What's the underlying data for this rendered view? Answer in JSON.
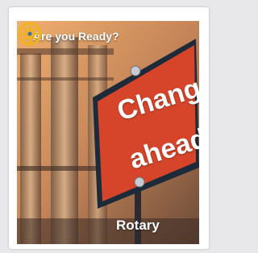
{
  "poster": {
    "headline": "Are you Ready?",
    "sign_line1": "Changes",
    "sign_line2": "ahead",
    "brand": "Rotary",
    "logo_icon": "rotary-wheel-icon"
  },
  "colors": {
    "sign_red": "#d6452a",
    "sign_frame": "#1d2a3a",
    "rotary_gold": "#f2b21a",
    "page_bg": "#e8e8ea"
  }
}
